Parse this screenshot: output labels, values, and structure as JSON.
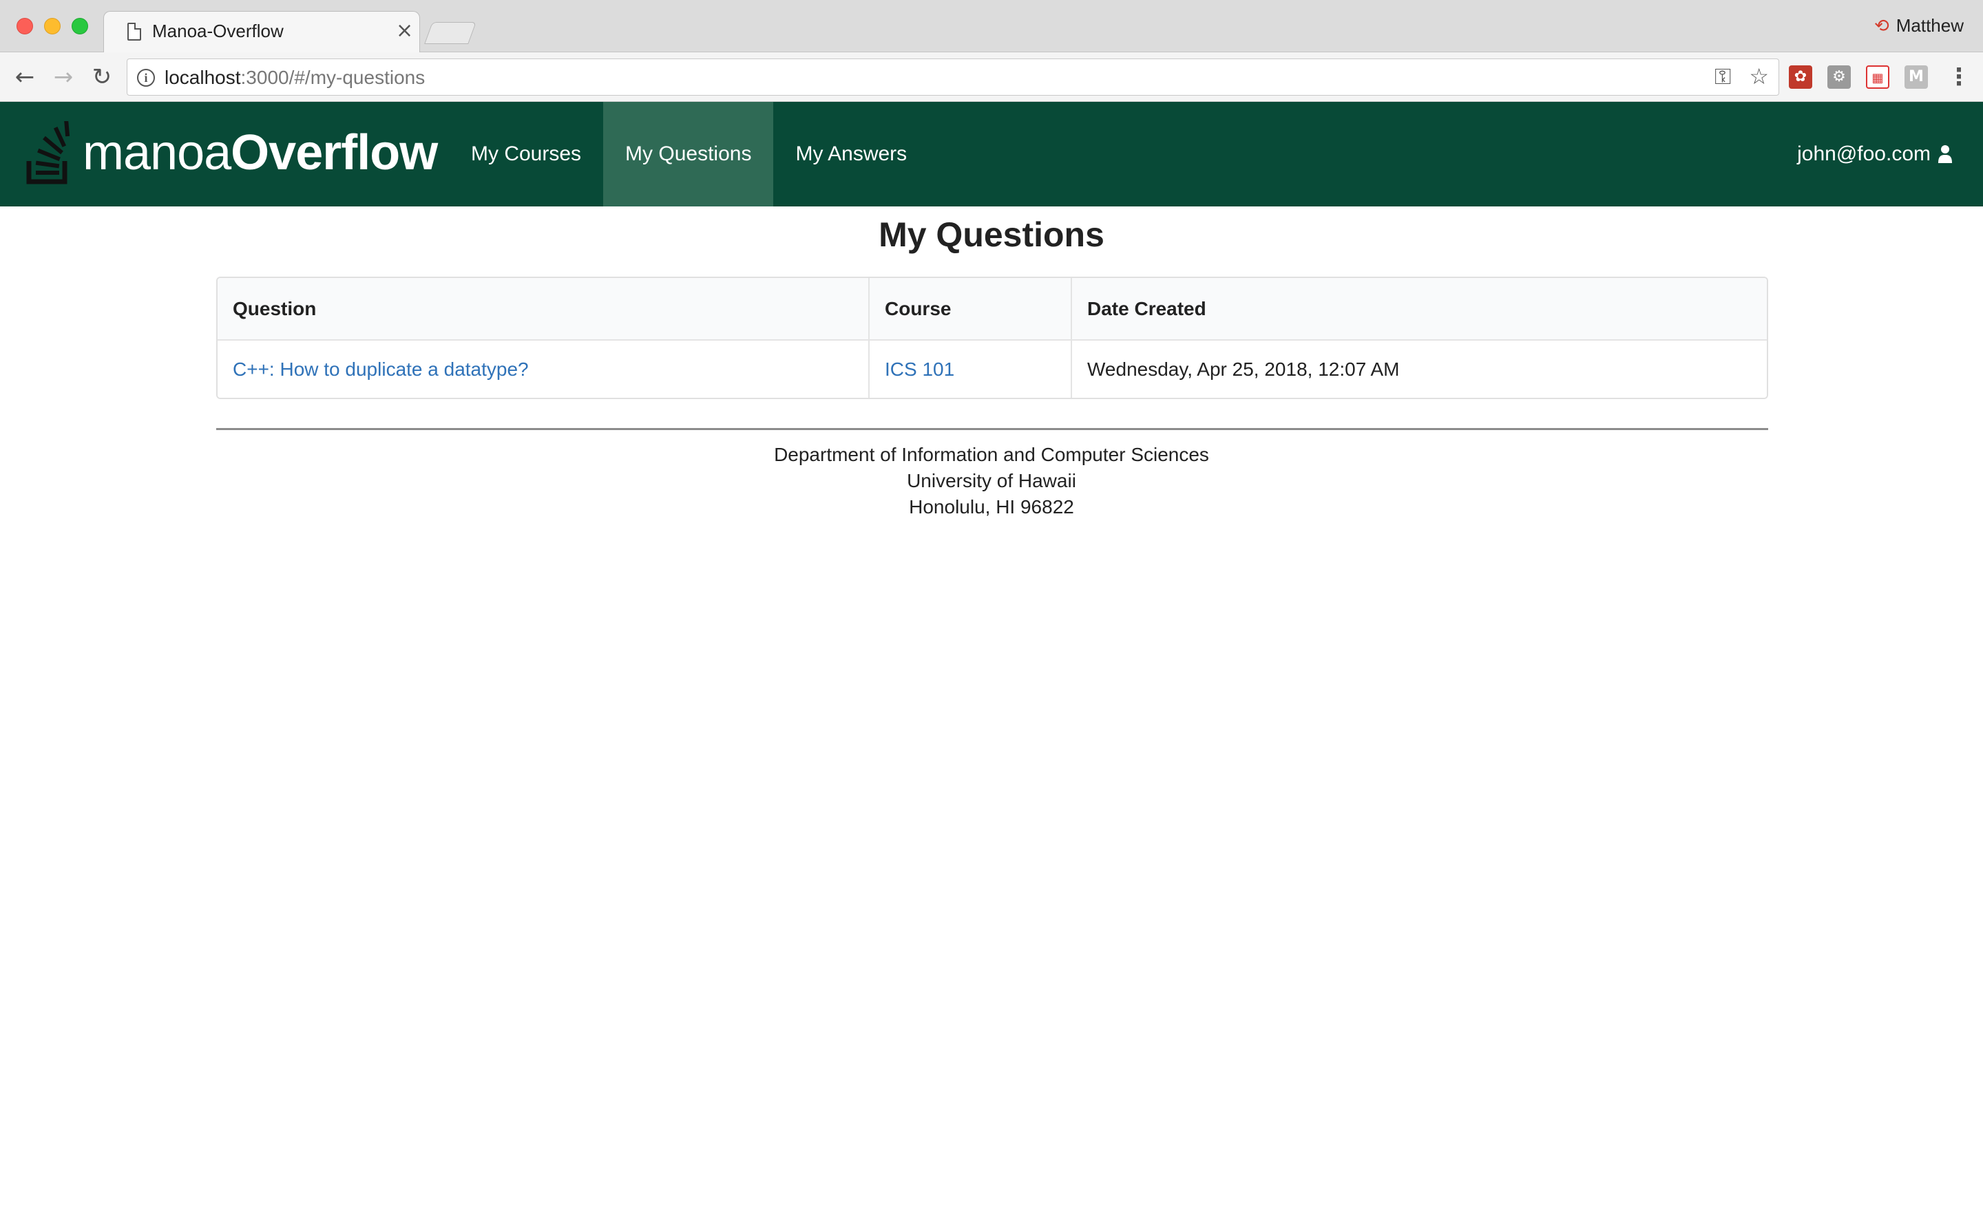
{
  "browser": {
    "tab_title": "Manoa-Overflow",
    "tab_close": "×",
    "profile_name": "Matthew",
    "url_host": "localhost",
    "url_path": ":3000/#/my-questions",
    "icons": [
      "back-arrow-icon",
      "forward-arrow-icon",
      "reload-icon",
      "info-icon",
      "key-icon",
      "star-icon",
      "menu-dots-icon"
    ]
  },
  "navbar": {
    "brand_light": "manoa",
    "brand_bold": "Overflow",
    "links": [
      {
        "label": "My Courses"
      },
      {
        "label": "My Questions",
        "active": true
      },
      {
        "label": "My Answers"
      }
    ],
    "user_email": "john@foo.com",
    "bg_color": "#084a37",
    "active_color": "#2f6a55"
  },
  "main": {
    "title": "My Questions",
    "table": {
      "headers": [
        "Question",
        "Course",
        "Date Created"
      ],
      "rows": [
        {
          "question": "C++: How to duplicate a datatype?",
          "course": "ICS 101",
          "date": "Wednesday, Apr 25, 2018, 12:07 AM"
        }
      ]
    },
    "link_color": "#2f72b8"
  },
  "footer": {
    "line1": "Department of Information and Computer Sciences",
    "line2": "University of Hawaii",
    "line3": "Honolulu, HI 96822"
  }
}
